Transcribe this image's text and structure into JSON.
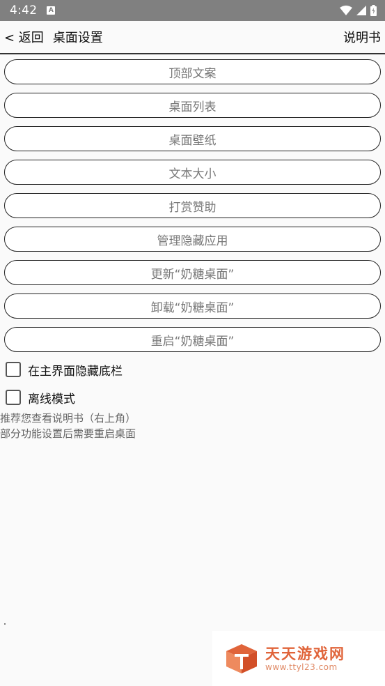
{
  "status_bar": {
    "time": "4:42",
    "notification_icon": "A",
    "icons": [
      "wifi-icon",
      "signal-icon",
      "battery-icon"
    ]
  },
  "app_bar": {
    "back_label": "< 返回",
    "title": "桌面设置",
    "help_label": "说明书"
  },
  "menu_items": [
    {
      "label": "顶部文案"
    },
    {
      "label": "桌面列表"
    },
    {
      "label": "桌面壁纸"
    },
    {
      "label": "文本大小"
    },
    {
      "label": "打赏赞助"
    },
    {
      "label": "管理隐藏应用"
    },
    {
      "label": "更新“奶糖桌面”"
    },
    {
      "label": "卸载“奶糖桌面”"
    },
    {
      "label": "重启“奶糖桌面”"
    }
  ],
  "options": [
    {
      "label": "在主界面隐藏底栏",
      "checked": false
    },
    {
      "label": "离线模式",
      "checked": false
    }
  ],
  "notes": [
    "推荐您查看说明书（右上角）",
    "部分功能设置后需要重启桌面"
  ],
  "watermark": {
    "text": "天天游戏网",
    "url": "www.ttyl23.com",
    "color": "#e0643a"
  }
}
